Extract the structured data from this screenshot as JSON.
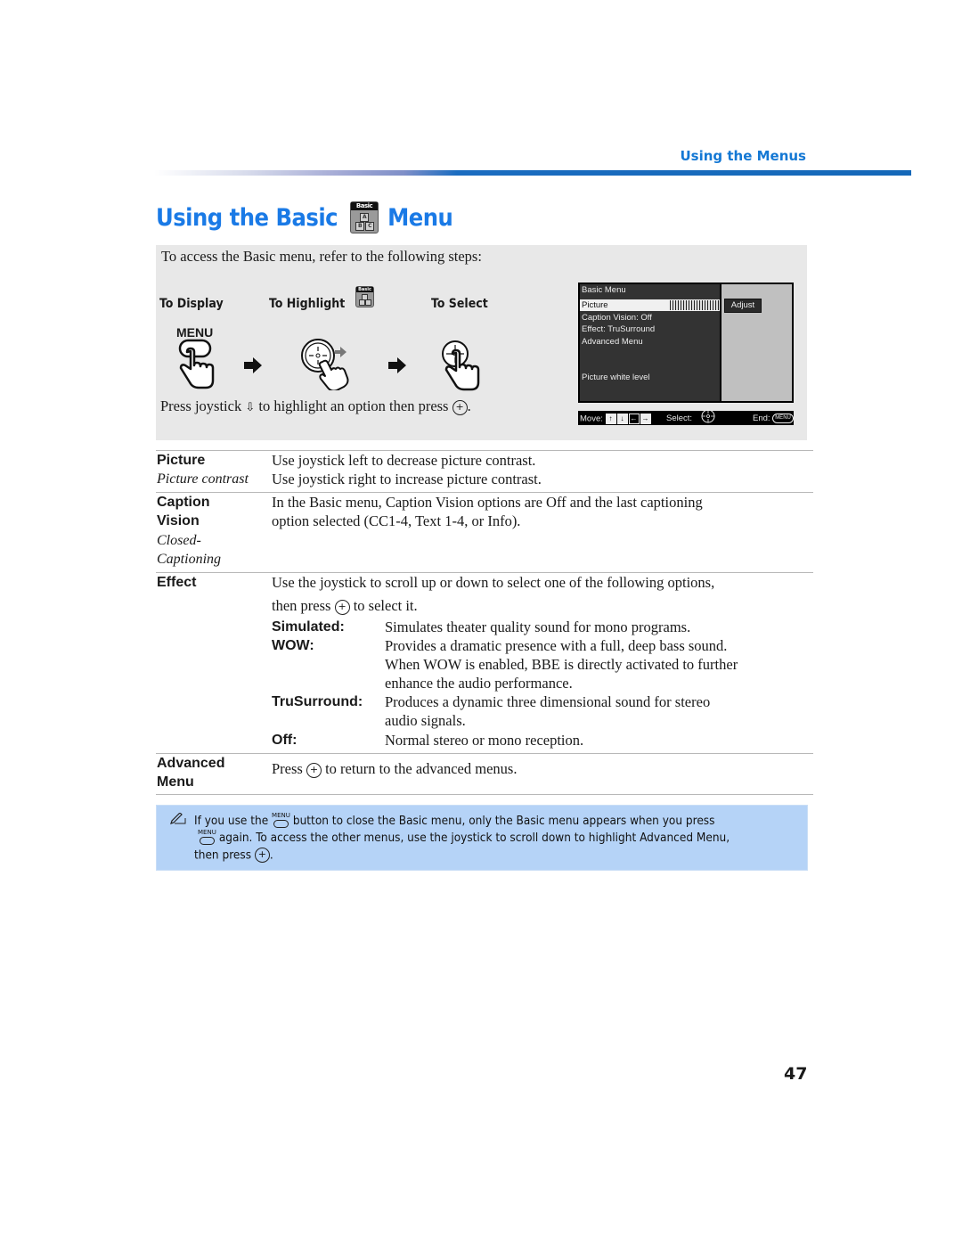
{
  "header": {
    "running_head": "Using the Menus",
    "page_title_part1": "Using the Basic",
    "page_title_part2": "Menu",
    "title_icon": "basic-menu-icon",
    "title_icon_label": "Basic",
    "title_icon_blocks": [
      "A",
      "B",
      "C"
    ]
  },
  "steps": {
    "intro": "To access the Basic menu, refer to the following steps:",
    "labels": [
      "To Display",
      "To Highlight",
      "To Select"
    ],
    "menu_button_label": "MENU",
    "icons": [
      "hand-press-menu-icon",
      "arrow-right-icon",
      "hand-joystick-icon",
      "arrow-right-icon",
      "hand-select-icon"
    ],
    "note_part1": "Press joystick",
    "note_part2": "to highlight an option then press",
    "note_end": ".",
    "down_arrow_glyph": "⇩",
    "plus_glyph": "+"
  },
  "osd": {
    "title": "Basic Menu",
    "items": [
      "Picture",
      "Caption Vision: Off",
      "Effect: TruSurround",
      "Advanced Menu"
    ],
    "selected_item": "Picture",
    "adjust_label": "Adjust",
    "help_text": "Picture white level",
    "footer": {
      "move_label": "Move:",
      "move_keys": [
        "↑",
        "↓",
        "←",
        "→"
      ],
      "select_label": "Select:",
      "end_label": "End:",
      "end_key": "MENU"
    }
  },
  "table": {
    "rows": [
      {
        "term": "Picture",
        "subterm": "Picture contrast",
        "desc": [
          "Use joystick left to decrease picture contrast.",
          "Use joystick right to increase picture contrast."
        ]
      },
      {
        "term_lines": [
          "Caption",
          "Vision"
        ],
        "subterm_lines": [
          "Closed-",
          "Captioning"
        ],
        "desc": [
          "In the Basic menu, Caption Vision options are Off and the last captioning",
          "option selected (CC1-4, Text 1-4, or Info)."
        ]
      },
      {
        "term": "Effect",
        "desc": [
          "Use the joystick to scroll up or down to select one of the following options,"
        ],
        "desc2_pre": "then press",
        "desc2_post": "to select it.",
        "options": [
          {
            "name": "Simulated:",
            "lines": [
              "Simulates theater quality sound for mono programs."
            ]
          },
          {
            "name": "WOW:",
            "lines": [
              "Provides a dramatic presence with a full, deep bass sound.",
              "When WOW is enabled, BBE is directly activated to further",
              "enhance the audio performance."
            ]
          },
          {
            "name": "TruSurround:",
            "lines": [
              "Produces a dynamic three dimensional sound for stereo",
              "audio signals."
            ]
          },
          {
            "name": "Off:",
            "lines": [
              "Normal stereo or mono reception."
            ]
          }
        ]
      },
      {
        "term_lines": [
          "Advanced",
          "Menu"
        ],
        "desc_pre": "Press",
        "desc_post": "to return to the advanced menus."
      }
    ]
  },
  "note": {
    "icon": "pencil-note-icon",
    "line1_pre": "If you use the",
    "line1_post": "button to close the Basic menu, only the Basic menu appears when you press",
    "line2_post": "again. To access the other menus, use the joystick to scroll down to highlight Advanced Menu,",
    "line3_pre": "then press",
    "line3_post": ".",
    "menu_button_label": "MENU"
  },
  "footer": {
    "page_number": "47"
  },
  "colors": {
    "accent": "#1a7ae6",
    "header_rule": "#1468b8",
    "panel_bg": "#e8e8e8",
    "note_bg": "#b5d3f7"
  }
}
